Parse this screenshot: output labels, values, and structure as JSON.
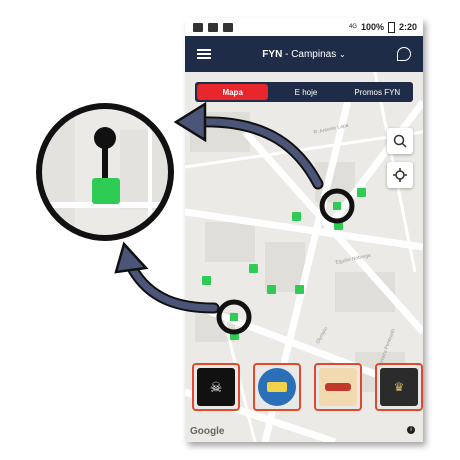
{
  "status_bar": {
    "battery": "100%",
    "time": "2:20",
    "network": "4G"
  },
  "app_bar": {
    "brand": "FYN",
    "separator": " - ",
    "city": "Campinas",
    "dropdown_icon": "chevron-down-icon",
    "menu_icon": "hamburger-menu-icon",
    "chat_icon": "chat-bubble-icon"
  },
  "tabs": [
    {
      "label": "Mapa",
      "active": true
    },
    {
      "label": "E hoje",
      "active": false
    },
    {
      "label": "Promos FYN",
      "active": false
    }
  ],
  "map": {
    "streets": [
      "R. Antonio Lapa",
      "Egydio Nóbrega",
      "Olympio",
      "R. Ferreira Penteado"
    ],
    "search_icon": "search-icon",
    "locate_icon": "crosshair-icon",
    "attribution": "Google",
    "pin_color": "#2ecc55"
  },
  "venues": [
    {
      "name": "venue-1",
      "colors": "#111111"
    },
    {
      "name": "venue-2",
      "colors": "#2a6fb8"
    },
    {
      "name": "venue-3",
      "colors": "#f3d9b0"
    },
    {
      "name": "venue-4",
      "colors": "#2b2b2b"
    }
  ],
  "accents": {
    "appbar": "#1f2c48",
    "active_tab": "#e8262b",
    "arrow": "#4a5578"
  }
}
